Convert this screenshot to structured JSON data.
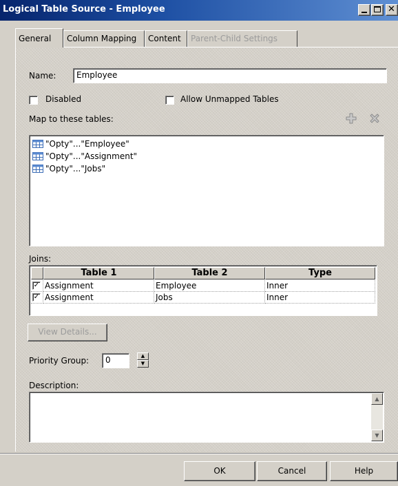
{
  "window": {
    "title": "Logical Table Source - Employee"
  },
  "tabs": [
    {
      "label": "General",
      "state": "active"
    },
    {
      "label": "Column Mapping",
      "state": "normal"
    },
    {
      "label": "Content",
      "state": "normal"
    },
    {
      "label": "Parent-Child Settings",
      "state": "disabled"
    }
  ],
  "form": {
    "name_label": "Name:",
    "name_value": "Employee",
    "disabled_label": "Disabled",
    "disabled_checked": false,
    "allow_unmapped_label": "Allow Unmapped Tables",
    "allow_unmapped_checked": false,
    "map_label": "Map to these tables:",
    "add_icon": "plus-icon",
    "delete_icon": "x-delete-icon"
  },
  "mapped_tables": [
    {
      "label": "\"Opty\"...\"Employee\"",
      "icon": "table-icon"
    },
    {
      "label": "\"Opty\"...\"Assignment\"",
      "icon": "table-icon"
    },
    {
      "label": "\"Opty\"...\"Jobs\"",
      "icon": "table-icon"
    }
  ],
  "joins": {
    "label": "Joins:",
    "columns": [
      "Table 1",
      "Table 2",
      "Type"
    ],
    "rows": [
      {
        "checked": true,
        "table1": "Assignment",
        "table2": "Employee",
        "type": "Inner"
      },
      {
        "checked": true,
        "table1": "Assignment",
        "table2": "Jobs",
        "type": "Inner"
      }
    ]
  },
  "view_details_label": "View Details...",
  "priority": {
    "label": "Priority Group:",
    "value": "0"
  },
  "description": {
    "label": "Description:",
    "value": ""
  },
  "buttons": {
    "ok": "OK",
    "cancel": "Cancel",
    "help": "Help"
  },
  "colors": {
    "titlebar": "#0a246a",
    "face": "#d4d0c8",
    "icon_plus": "#9b9b9b"
  }
}
